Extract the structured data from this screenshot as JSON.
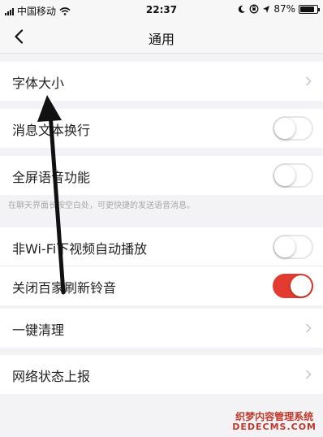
{
  "status_bar": {
    "carrier": "中国移动",
    "time": "22:37",
    "battery": "87%",
    "battery_level": 0.87
  },
  "nav": {
    "back_icon": "chevron-left-icon",
    "title": "通用"
  },
  "rows": {
    "font_size": {
      "label": "字体大小"
    },
    "enter_newline": {
      "label": "消息文本换行",
      "on": false
    },
    "fullscreen_voice": {
      "label": "全屏语音功能",
      "on": false
    },
    "voice_hint": "在聊天界面长按空白处，可更快捷的发送语音消息。",
    "autoplay_video": {
      "label": "非Wi-Fi下视频自动播放",
      "on": false
    },
    "close_ringtone": {
      "label": "关闭百家刷新铃音",
      "on": true
    },
    "clear": {
      "label": "一键清理"
    },
    "network_report": {
      "label": "网络状态上报"
    }
  },
  "colors": {
    "toggle_on": "#e33b30",
    "annotation_arrow": "#111111"
  },
  "watermark": {
    "line1": "织梦内容管理系统",
    "line2": "DEDECMS.COM"
  }
}
